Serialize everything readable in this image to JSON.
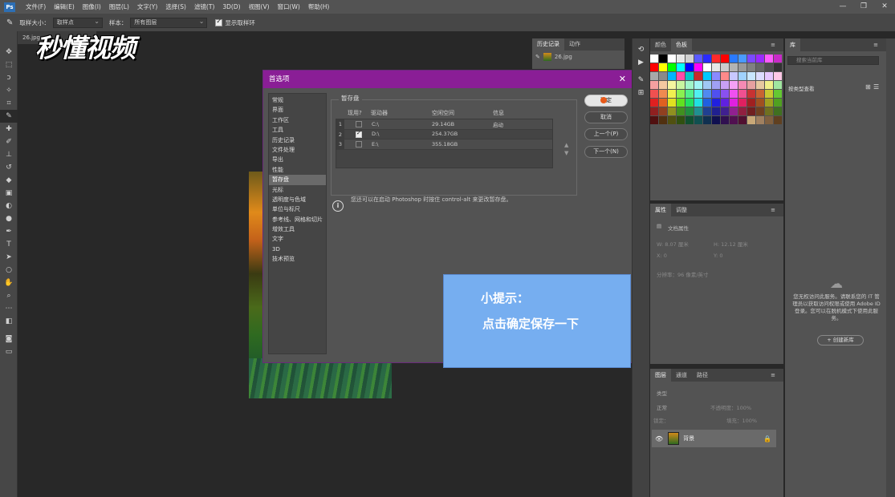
{
  "menu": {
    "logo": "Ps",
    "items": [
      "文件(F)",
      "编辑(E)",
      "图像(I)",
      "图层(L)",
      "文字(Y)",
      "选择(S)",
      "滤镜(T)",
      "3D(D)",
      "视图(V)",
      "窗口(W)",
      "帮助(H)"
    ]
  },
  "options": {
    "sample_size_label": "取样大小：",
    "sample_size_value": "取样点",
    "sample_label": "样本：",
    "sample_value": "所有图层",
    "show_ring_label": "显示取样环"
  },
  "document": {
    "tab": "26.jpg"
  },
  "watermark": "秒懂视频",
  "history": {
    "tabs": [
      "历史记录",
      "动作"
    ],
    "item": "26.jpg"
  },
  "dialog": {
    "title": "首选项",
    "categories": [
      "常规",
      "界面",
      "工作区",
      "工具",
      "历史记录",
      "文件处理",
      "导出",
      "性能",
      "暂存盘",
      "光标",
      "透明度与色域",
      "单位与标尺",
      "参考线、网格和切片",
      "增效工具",
      "文字",
      "3D",
      "技术预览"
    ],
    "selected_category": "暂存盘",
    "scratch": {
      "legend": "暂存盘",
      "headers": [
        "现用?",
        "驱动器",
        "空闲空间",
        "信息"
      ],
      "rows": [
        {
          "num": "1",
          "active": false,
          "drive": "C:\\",
          "space": "29.14GB",
          "info": "启动"
        },
        {
          "num": "2",
          "active": true,
          "drive": "D:\\",
          "space": "254.37GB",
          "info": ""
        },
        {
          "num": "3",
          "active": false,
          "drive": "E:\\",
          "space": "355.18GB",
          "info": ""
        }
      ]
    },
    "hint": "您还可以在启动 Photoshop 时按住 control-alt 来更改暂存盘。",
    "buttons": {
      "ok": "确定",
      "cancel": "取消",
      "prev": "上一个(P)",
      "next": "下一个(N)"
    }
  },
  "tip": {
    "title": "小提示：",
    "body": "点击确定保存一下"
  },
  "panels": {
    "color_tabs": [
      "颜色",
      "色板"
    ],
    "props_tabs": [
      "属性",
      "调整"
    ],
    "doc_props": "文档属性",
    "w_label": "W:  8.07 厘米",
    "h_label": "H:  12.12 厘米",
    "x_label": "X:  0",
    "y_label": "Y:  0",
    "resolution": "分辨率：96 像素/英寸",
    "layer_tabs": [
      "图层",
      "通道",
      "路径"
    ],
    "layer_kind": "类型",
    "blend_mode": "正常",
    "opacity": "不透明度：100%",
    "lock": "锁定：",
    "fill": "填充：100%",
    "layer_name": "背景",
    "lib_title": "库",
    "lib_search": "搜索当前库",
    "lib_view": "按类型查看",
    "lib_note": "您无权访问此服务。请联系您的 IT 管理员以获取访问权限或使用 Adobe ID 登录。您可以在脱机模式下使用此服务。",
    "lib_btn": "+ 创建新库"
  },
  "swatch_colors": [
    "#ffffff",
    "#000000",
    "#ffffff",
    "#e8e8e8",
    "#d0d0d0",
    "#5a5aff",
    "#2a2aff",
    "#ff2a2a",
    "#ff0000",
    "#2a7aff",
    "#4a9aff",
    "#7a4aff",
    "#9a2aff",
    "#ff5aff",
    "#c82ac8",
    "#ff0000",
    "#ffff00",
    "#00ff00",
    "#00ffff",
    "#0000ff",
    "#ff00ff",
    "#ffffff",
    "#e6e6e6",
    "#cccccc",
    "#b3b3b3",
    "#999999",
    "#808080",
    "#666666",
    "#4d4d4d",
    "#333333",
    "#a8a8a8",
    "#8a8a8a",
    "#00b4ff",
    "#ff4aa8",
    "#00c8c8",
    "#c82a2a",
    "#00c8ff",
    "#8a8aff",
    "#ff8a8a",
    "#c8c8ff",
    "#a0d2ff",
    "#c8e6ff",
    "#dcdcff",
    "#e6c8ff",
    "#ffc8e6",
    "#f5a0a0",
    "#f5c8a0",
    "#f5f5a0",
    "#c8f5a0",
    "#a0f5c8",
    "#a0f5f5",
    "#a0c8f5",
    "#a0a0f5",
    "#c8a0f5",
    "#f5a0f5",
    "#f58ab4",
    "#e6a0a0",
    "#e6c8a0",
    "#f0f08a",
    "#a0e6a0",
    "#f05050",
    "#f08a50",
    "#f0f050",
    "#8af050",
    "#50f08a",
    "#50f0f0",
    "#508af0",
    "#5050f0",
    "#8a50f0",
    "#f050f0",
    "#f05090",
    "#c83232",
    "#c86432",
    "#c8c832",
    "#64c832",
    "#e02020",
    "#e06020",
    "#e0e020",
    "#60e020",
    "#20e060",
    "#20e0e0",
    "#2060e0",
    "#2020e0",
    "#6020e0",
    "#e020e0",
    "#e02060",
    "#a02020",
    "#a05020",
    "#a0a020",
    "#50a020",
    "#902020",
    "#904020",
    "#909020",
    "#409020",
    "#209040",
    "#209090",
    "#204090",
    "#202090",
    "#402090",
    "#902090",
    "#902040",
    "#702020",
    "#704020",
    "#707020",
    "#407020",
    "#501010",
    "#503010",
    "#505010",
    "#305010",
    "#105030",
    "#105050",
    "#103050",
    "#101050",
    "#301050",
    "#501050",
    "#501030",
    "#c8a878",
    "#a08060",
    "#806040",
    "#604020"
  ]
}
